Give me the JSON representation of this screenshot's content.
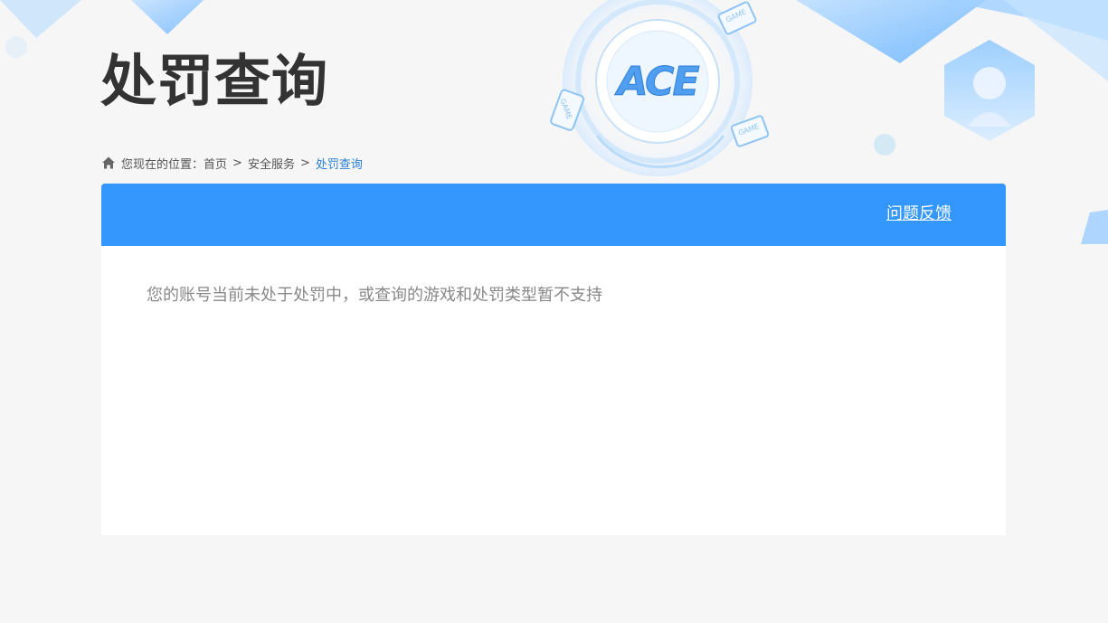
{
  "header": {
    "title": "处罚查询",
    "logo_text": "ACE",
    "deco_labels": [
      "GAME",
      "GAME",
      "GAME"
    ]
  },
  "breadcrumb": {
    "prefix": "您现在的位置：",
    "items": [
      {
        "label": "首页"
      },
      {
        "label": "安全服务"
      },
      {
        "label": "处罚查询"
      }
    ],
    "separator": ">"
  },
  "panel": {
    "feedback_label": "问题反馈",
    "message": "您的账号当前未处于处罚中，或查询的游戏和处罚类型暂不支持"
  },
  "colors": {
    "accent": "#3497fd",
    "title": "#333333",
    "message": "#888888",
    "breadcrumb_current": "#2a7fd4",
    "background": "#f6f6f6"
  }
}
